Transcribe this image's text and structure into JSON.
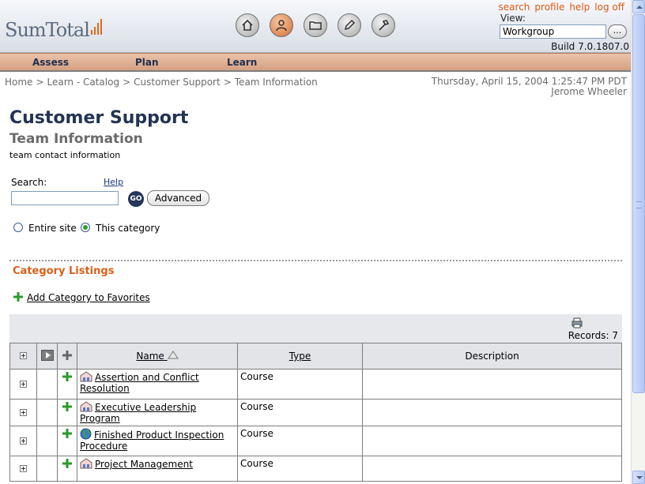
{
  "header": {
    "logo_text": "SumTotal",
    "top_links": [
      "search",
      "profile",
      "help",
      "log off"
    ],
    "view_label": "View:",
    "view_value": "Workgroup",
    "view_button": "...",
    "build": "Build 7.0.1807.0",
    "toolbar_icons": [
      "home-icon",
      "profile-icon",
      "folder-icon",
      "pencil-icon",
      "hammer-icon"
    ]
  },
  "nav": {
    "items": [
      "Assess",
      "Plan",
      "Learn"
    ]
  },
  "breadcrumb": [
    "Home",
    "Learn - Catalog",
    "Customer Support",
    "Team Information"
  ],
  "breadcrumb_sep": ">",
  "datetime": "Thursday, April 15, 2004 1:25:47 PM PDT",
  "user": "Jerome Wheeler",
  "page": {
    "title": "Customer Support",
    "subtitle": "Team Information",
    "description": "team contact information"
  },
  "search": {
    "label": "Search:",
    "help": "Help",
    "value": "",
    "go": "GO",
    "advanced": "Advanced",
    "scope_options": [
      "Entire site",
      "This category"
    ],
    "scope_selected": "This category"
  },
  "listings": {
    "title": "Category Listings",
    "add_favorites": "Add Category to Favorites",
    "records": "Records: 7",
    "columns": [
      "Name",
      "Type",
      "Description"
    ],
    "rows": [
      {
        "name": "Assertion and Conflict Resolution",
        "type": "Course",
        "description": "",
        "icon": "course-building-icon"
      },
      {
        "name": "Executive Leadership Program",
        "type": "Course",
        "description": "",
        "icon": "course-building-icon"
      },
      {
        "name": "Finished Product Inspection Procedure",
        "type": "Course",
        "description": "",
        "icon": "globe-icon"
      },
      {
        "name": "Project Management",
        "type": "Course",
        "description": "",
        "icon": "course-building-icon"
      }
    ]
  },
  "colors": {
    "accent": "#e05a14",
    "title": "#233452",
    "nav_bg": "#d5a080"
  }
}
